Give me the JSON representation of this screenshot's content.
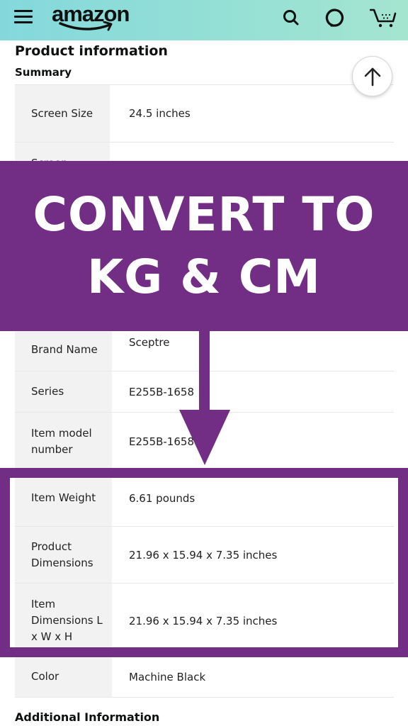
{
  "header": {
    "logo": "amazon",
    "icons": [
      "hamburger-menu-icon",
      "search-icon",
      "alexa-icon",
      "cart-icon"
    ]
  },
  "page": {
    "section_title": "Product information",
    "subsection_title": "Summary",
    "additional_title": "Additional Information",
    "scroll_top_icon": "arrow-up-icon"
  },
  "rows": [
    {
      "label": "Screen Size",
      "value": "24.5 inches"
    },
    {
      "label": "Screen",
      "value": ""
    },
    {
      "label": "Brand Name",
      "value": "Sceptre"
    },
    {
      "label": "Series",
      "value": "E255B-1658"
    },
    {
      "label": "Item model number",
      "value": "E255B-1658"
    },
    {
      "label": "Item Weight",
      "value": "6.61 pounds"
    },
    {
      "label": "Product Dimensions",
      "value": "21.96 x 15.94 x 7.35 inches"
    },
    {
      "label": "Item Dimensions L x W x H",
      "value": "21.96 x 15.94 x 7.35 inches"
    },
    {
      "label": "Color",
      "value": "Machine Black"
    }
  ],
  "overlay": {
    "line1": "CONVERT TO",
    "line2": "KG & CM",
    "color": "#722d85"
  }
}
